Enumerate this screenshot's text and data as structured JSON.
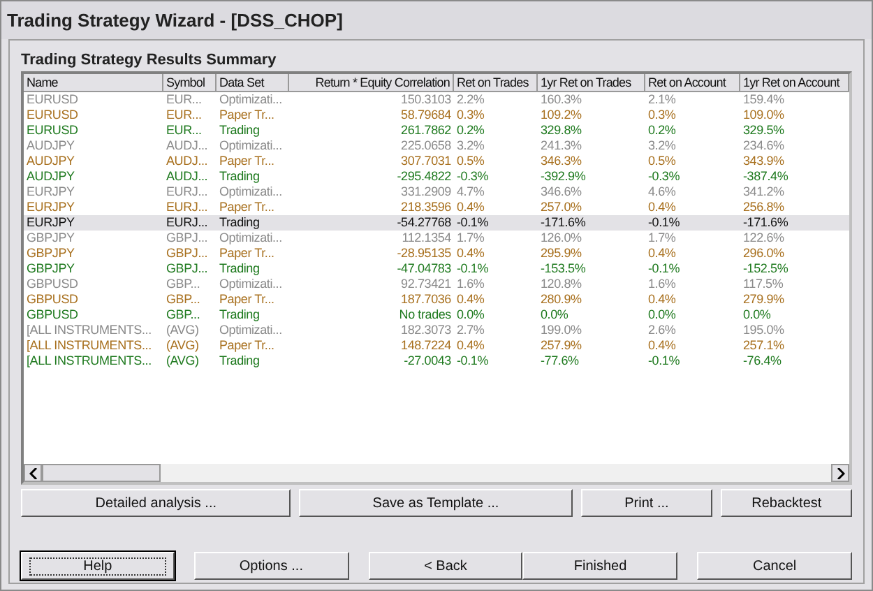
{
  "window": {
    "title": "Trading Strategy Wizard - [DSS_CHOP]"
  },
  "section_title": "Trading Strategy Results Summary",
  "table": {
    "columns": [
      "Name",
      "Symbol",
      "Data Set",
      "Return * Equity Correlation",
      "Ret on Trades",
      "1yr Ret on Trades",
      "Ret on Account",
      "1yr Ret on Account"
    ],
    "rows": [
      {
        "kind": "optimization",
        "selected": false,
        "cells": [
          "EURUSD",
          "EUR...",
          "Optimizati...",
          "150.3103",
          "2.2%",
          "160.3%",
          "2.1%",
          "159.4%"
        ]
      },
      {
        "kind": "paper",
        "selected": false,
        "cells": [
          "EURUSD",
          "EUR...",
          "Paper Tr...",
          "58.79684",
          "0.3%",
          "109.2%",
          "0.3%",
          "109.0%"
        ]
      },
      {
        "kind": "trading",
        "selected": false,
        "cells": [
          "EURUSD",
          "EUR...",
          "Trading",
          "261.7862",
          "0.2%",
          "329.8%",
          "0.2%",
          "329.5%"
        ]
      },
      {
        "kind": "optimization",
        "selected": false,
        "cells": [
          "AUDJPY",
          "AUDJ...",
          "Optimizati...",
          "225.0658",
          "3.2%",
          "241.3%",
          "3.2%",
          "234.6%"
        ]
      },
      {
        "kind": "paper",
        "selected": false,
        "cells": [
          "AUDJPY",
          "AUDJ...",
          "Paper Tr...",
          "307.7031",
          "0.5%",
          "346.3%",
          "0.5%",
          "343.9%"
        ]
      },
      {
        "kind": "trading",
        "selected": false,
        "cells": [
          "AUDJPY",
          "AUDJ...",
          "Trading",
          "-295.4822",
          "-0.3%",
          "-392.9%",
          "-0.3%",
          "-387.4%"
        ]
      },
      {
        "kind": "optimization",
        "selected": false,
        "cells": [
          "EURJPY",
          "EURJ...",
          "Optimizati...",
          "331.2909",
          "4.7%",
          "346.6%",
          "4.6%",
          "341.2%"
        ]
      },
      {
        "kind": "paper",
        "selected": false,
        "cells": [
          "EURJPY",
          "EURJ...",
          "Paper Tr...",
          "218.3596",
          "0.4%",
          "257.0%",
          "0.4%",
          "256.8%"
        ]
      },
      {
        "kind": "trading",
        "selected": true,
        "cells": [
          "EURJPY",
          "EURJ...",
          "Trading",
          "-54.27768",
          "-0.1%",
          "-171.6%",
          "-0.1%",
          "-171.6%"
        ]
      },
      {
        "kind": "optimization",
        "selected": false,
        "cells": [
          "GBPJPY",
          "GBPJ...",
          "Optimizati...",
          "112.1354",
          "1.7%",
          "126.0%",
          "1.7%",
          "122.6%"
        ]
      },
      {
        "kind": "paper",
        "selected": false,
        "cells": [
          "GBPJPY",
          "GBPJ...",
          "Paper Tr...",
          "-28.95135",
          "0.4%",
          "295.9%",
          "0.4%",
          "296.0%"
        ]
      },
      {
        "kind": "trading",
        "selected": false,
        "cells": [
          "GBPJPY",
          "GBPJ...",
          "Trading",
          "-47.04783",
          "-0.1%",
          "-153.5%",
          "-0.1%",
          "-152.5%"
        ]
      },
      {
        "kind": "optimization",
        "selected": false,
        "cells": [
          "GBPUSD",
          "GBP...",
          "Optimizati...",
          "92.73421",
          "1.6%",
          "120.8%",
          "1.6%",
          "117.5%"
        ]
      },
      {
        "kind": "paper",
        "selected": false,
        "cells": [
          "GBPUSD",
          "GBP...",
          "Paper Tr...",
          "187.7036",
          "0.4%",
          "280.9%",
          "0.4%",
          "279.9%"
        ]
      },
      {
        "kind": "trading",
        "selected": false,
        "cells": [
          "GBPUSD",
          "GBP...",
          "Trading",
          "No trades",
          "0.0%",
          "0.0%",
          "0.0%",
          "0.0%"
        ]
      },
      {
        "kind": "optimization",
        "selected": false,
        "cells": [
          "[ALL INSTRUMENTS...",
          "(AVG)",
          "Optimizati...",
          "182.3073",
          "2.7%",
          "199.0%",
          "2.6%",
          "195.0%"
        ]
      },
      {
        "kind": "paper",
        "selected": false,
        "cells": [
          "[ALL INSTRUMENTS...",
          "(AVG)",
          "Paper Tr...",
          "148.7224",
          "0.4%",
          "257.9%",
          "0.4%",
          "257.1%"
        ]
      },
      {
        "kind": "trading",
        "selected": false,
        "cells": [
          "[ALL INSTRUMENTS...",
          "(AVG)",
          "Trading",
          "-27.0043",
          "-0.1%",
          "-77.6%",
          "-0.1%",
          "-76.4%"
        ]
      }
    ]
  },
  "action_buttons": [
    "Detailed analysis ...",
    "Save as Template ...",
    "Print ...",
    "Rebacktest"
  ],
  "nav_buttons": [
    {
      "label": "Help",
      "focused": true
    },
    {
      "label": "Options ...",
      "focused": false
    },
    {
      "label": "< Back",
      "focused": false
    },
    {
      "label": "Finished",
      "focused": false
    },
    {
      "label": "Cancel",
      "focused": false
    }
  ]
}
